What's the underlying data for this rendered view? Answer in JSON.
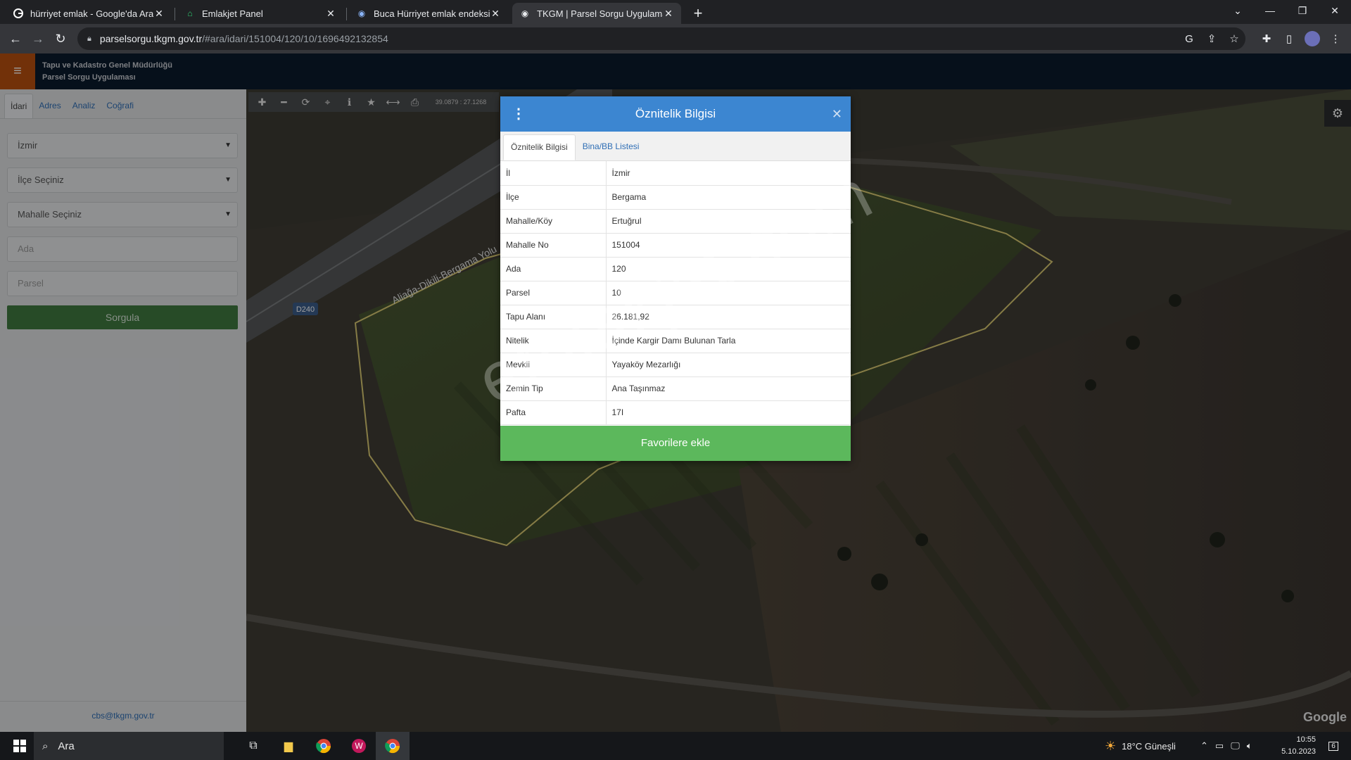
{
  "browser": {
    "tabs": [
      {
        "title": "hürriyet emlak - Google'da Ara",
        "icon": "google-icon",
        "active": false
      },
      {
        "title": "Emlakjet Panel",
        "icon": "emlakjet-icon",
        "active": false
      },
      {
        "title": "Buca Hürriyet emlak endeksi & E",
        "icon": "map-pin-icon",
        "active": false
      },
      {
        "title": "TKGM | Parsel Sorgu Uygulaması",
        "icon": "map-pin-icon",
        "active": true
      }
    ],
    "url_host": "parselsorgu.tkgm.gov.tr",
    "url_path": "/#ara/idari/151004/120/10/1696492132854"
  },
  "app": {
    "title_line1": "Tapu ve Kadastro Genel Müdürlüğü",
    "title_line2": "Parsel Sorgu Uygulaması"
  },
  "sidebar": {
    "tabs": [
      "İdari",
      "Adres",
      "Analiz",
      "Coğrafi"
    ],
    "province": "İzmir",
    "district_placeholder": "İlçe Seçiniz",
    "neighborhood_placeholder": "Mahalle Seçiniz",
    "ada_placeholder": "Ada",
    "parsel_placeholder": "Parsel",
    "query_button": "Sorgula",
    "footer_email": "cbs@tkgm.gov.tr"
  },
  "map": {
    "coords": "39.0879 : 27.1268",
    "road_label": "Aliağa-Dikili-Bergama Yolu",
    "road_code": "D240",
    "attribution": "Google"
  },
  "modal": {
    "title": "Öznitelik Bilgisi",
    "tabs": [
      "Öznitelik Bilgisi",
      "Bina/BB Listesi"
    ],
    "rows": [
      {
        "key": "İl",
        "value": "İzmir"
      },
      {
        "key": "İlçe",
        "value": "Bergama"
      },
      {
        "key": "Mahalle/Köy",
        "value": "Ertuğrul"
      },
      {
        "key": "Mahalle No",
        "value": "151004"
      },
      {
        "key": "Ada",
        "value": "120"
      },
      {
        "key": "Parsel",
        "value": "10"
      },
      {
        "key": "Tapu Alanı",
        "value": "26.181,92"
      },
      {
        "key": "Nitelik",
        "value": "İçinde Kargir Damı Bulunan Tarla"
      },
      {
        "key": "Mevkii",
        "value": "Yayaköy Mezarlığı"
      },
      {
        "key": "Zemin Tip",
        "value": "Ana Taşınmaz"
      },
      {
        "key": "Pafta",
        "value": "17I"
      }
    ],
    "favorite_button": "Favorilere ekle"
  },
  "watermark": "emlakjet.com",
  "taskbar": {
    "search_label": "Ara",
    "weather": "18°C  Güneşli",
    "time": "10:55",
    "date": "5.10.2023",
    "notification_count": "6"
  }
}
